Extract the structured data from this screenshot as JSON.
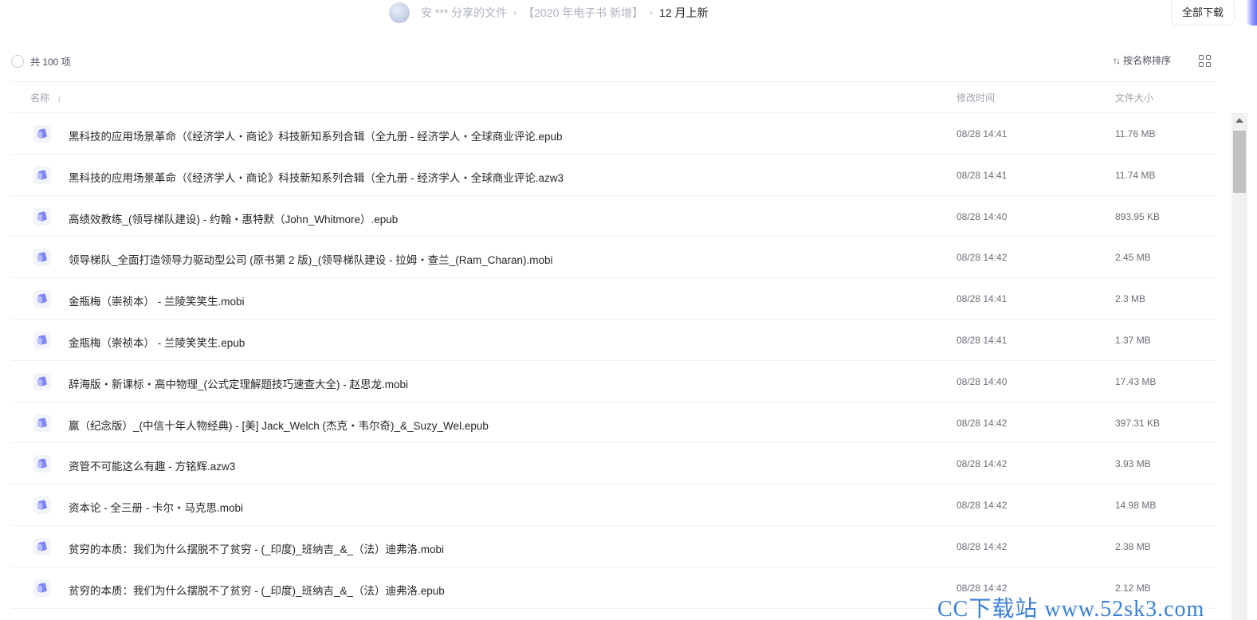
{
  "breadcrumb": {
    "owner": "安 *** 分享的文件",
    "parent": "【2020 年电子书 新增】",
    "current": "12 月上新",
    "separator": "›"
  },
  "toolbar": {
    "download_all_label": "全部下载",
    "count_label": "共 100 项",
    "sort_label": "按名称排序",
    "sort_icon": "↑↓"
  },
  "columns": {
    "name": "名称",
    "name_sort_icon": "↓",
    "modified": "修改时间",
    "size": "文件大小"
  },
  "files": [
    {
      "name": "黑科技的应用场景革命（《经济学人・商论》科技新知系列合辑（全九册 - 经济学人・全球商业评论.epub",
      "time": "08/28 14:41",
      "size": "11.76 MB"
    },
    {
      "name": "黑科技的应用场景革命（《经济学人・商论》科技新知系列合辑（全九册 - 经济学人・全球商业评论.azw3",
      "time": "08/28 14:41",
      "size": "11.74 MB"
    },
    {
      "name": "高绩效教练_(领导梯队建设) - 约翰・惠特默（John_Whitmore）.epub",
      "time": "08/28 14:40",
      "size": "893.95 KB"
    },
    {
      "name": "领导梯队_全面打造领导力驱动型公司 (原书第 2 版)_(领导梯队建设 - 拉姆・查兰_(Ram_Charan).mobi",
      "time": "08/28 14:42",
      "size": "2.45 MB"
    },
    {
      "name": "金瓶梅（崇祯本） - 兰陵笑笑生.mobi",
      "time": "08/28 14:41",
      "size": "2.3 MB"
    },
    {
      "name": "金瓶梅（崇祯本） - 兰陵笑笑生.epub",
      "time": "08/28 14:41",
      "size": "1.37 MB"
    },
    {
      "name": "辞海版・新课标・高中物理_(公式定理解题技巧速查大全) - 赵思龙.mobi",
      "time": "08/28 14:40",
      "size": "17.43 MB"
    },
    {
      "name": "赢（纪念版）_(中信十年人物经典) - [美] Jack_Welch (杰克・韦尔奇)_&_Suzy_Wel.epub",
      "time": "08/28 14:42",
      "size": "397.31 KB"
    },
    {
      "name": "资管不可能这么有趣 - 方铭辉.azw3",
      "time": "08/28 14:42",
      "size": "3.93 MB"
    },
    {
      "name": "资本论 - 全三册 - 卡尔・马克思.mobi",
      "time": "08/28 14:42",
      "size": "14.98 MB"
    },
    {
      "name": "贫穷的本质：我们为什么摆脱不了贫穷 - (_印度)_班纳吉_&_（法）迪弗洛.mobi",
      "time": "08/28 14:42",
      "size": "2.38 MB"
    },
    {
      "name": "贫穷的本质：我们为什么摆脱不了贫穷 - (_印度)_班纳吉_&_（法）迪弗洛.epub",
      "time": "08/28 14:42",
      "size": "2.12 MB"
    }
  ],
  "watermark": "CC下载站 www.52sk3.com",
  "colors": {
    "accent": "#7f86f5",
    "text": "#25262b",
    "muted": "#9fa2ad"
  }
}
